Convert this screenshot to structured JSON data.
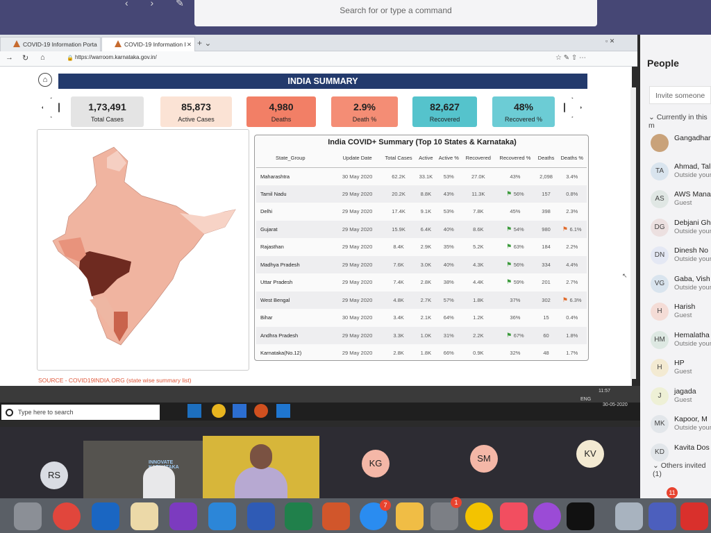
{
  "teams": {
    "search_placeholder": "Search for or type a command"
  },
  "browser": {
    "tabs": [
      {
        "label": "COVID-19 Information Porta"
      },
      {
        "label": "COVID-19 Information I"
      }
    ],
    "url": "https://warroom.karnataka.gov.in/"
  },
  "dashboard": {
    "title": "INDIA SUMMARY",
    "kpis": [
      {
        "value": "1,73,491",
        "label": "Total Cases",
        "color": "#e4e4e4"
      },
      {
        "value": "85,873",
        "label": "Active Cases",
        "color": "#fbe3d5"
      },
      {
        "value": "4,980",
        "label": "Deaths",
        "color": "#f27f66"
      },
      {
        "value": "2.9%",
        "label": "Death %",
        "color": "#f48d75"
      },
      {
        "value": "82,627",
        "label": "Recovered",
        "color": "#55c3cc"
      },
      {
        "value": "48%",
        "label": "Recovered %",
        "color": "#6cccd5"
      }
    ],
    "source": "SOURCE - COVID19INDIA.ORG (state wise summary list)",
    "table_title": "India COVID+ Summary (Top 10 States & Karnataka)",
    "columns": [
      "State_Group",
      "Update Date",
      "Total Cases",
      "Active",
      "Active %",
      "Recovered",
      "Recovered %",
      "Deaths",
      "Deaths %"
    ],
    "rows": [
      [
        "Maharashtra",
        "30 May 2020",
        "62.2K",
        "33.1K",
        "53%",
        "27.0K",
        "43%",
        "2,098",
        "3.4%",
        "",
        ""
      ],
      [
        "Tamil Nadu",
        "29 May 2020",
        "20.2K",
        "8.8K",
        "43%",
        "11.3K",
        "56%",
        "157",
        "0.8%",
        "g",
        ""
      ],
      [
        "Delhi",
        "29 May 2020",
        "17.4K",
        "9.1K",
        "53%",
        "7.8K",
        "45%",
        "398",
        "2.3%",
        "",
        ""
      ],
      [
        "Gujarat",
        "29 May 2020",
        "15.9K",
        "6.4K",
        "40%",
        "8.6K",
        "54%",
        "980",
        "6.1%",
        "g",
        "r"
      ],
      [
        "Rajasthan",
        "29 May 2020",
        "8.4K",
        "2.9K",
        "35%",
        "5.2K",
        "63%",
        "184",
        "2.2%",
        "g",
        ""
      ],
      [
        "Madhya Pradesh",
        "29 May 2020",
        "7.6K",
        "3.0K",
        "40%",
        "4.3K",
        "56%",
        "334",
        "4.4%",
        "g",
        ""
      ],
      [
        "Uttar Pradesh",
        "29 May 2020",
        "7.4K",
        "2.8K",
        "38%",
        "4.4K",
        "59%",
        "201",
        "2.7%",
        "g",
        ""
      ],
      [
        "West Bengal",
        "29 May 2020",
        "4.8K",
        "2.7K",
        "57%",
        "1.8K",
        "37%",
        "302",
        "6.3%",
        "",
        "r"
      ],
      [
        "Bihar",
        "30 May 2020",
        "3.4K",
        "2.1K",
        "64%",
        "1.2K",
        "36%",
        "15",
        "0.4%",
        "",
        ""
      ],
      [
        "Andhra Pradesh",
        "29 May 2020",
        "3.3K",
        "1.0K",
        "31%",
        "2.2K",
        "67%",
        "60",
        "1.8%",
        "g",
        ""
      ],
      [
        "Karnataka(No.12)",
        "29 May 2020",
        "2.8K",
        "1.8K",
        "66%",
        "0.9K",
        "32%",
        "48",
        "1.7%",
        "",
        ""
      ]
    ]
  },
  "windows": {
    "search": "Type here to search",
    "time": "11:57",
    "date": "30-05-2020",
    "lang": "ENG"
  },
  "people": {
    "title": "People",
    "invite": "Invite someone",
    "current": "Currently in this m",
    "list": [
      {
        "initials": "",
        "name": "Gangadhar",
        "status": "",
        "color": "#c9a27a"
      },
      {
        "initials": "TA",
        "name": "Ahmad, Tal",
        "status": "Outside your",
        "color": "#d9e4ee"
      },
      {
        "initials": "AS",
        "name": "AWS Mana",
        "status": "Guest",
        "color": "#e0e7e4"
      },
      {
        "initials": "DG",
        "name": "Debjani Gh",
        "status": "Outside your",
        "color": "#ece0e0"
      },
      {
        "initials": "DN",
        "name": "Dinesh No",
        "status": "Outside your",
        "color": "#e4e8f4"
      },
      {
        "initials": "VG",
        "name": "Gaba, Vish",
        "status": "Outside your",
        "color": "#d9e4ee"
      },
      {
        "initials": "H",
        "name": "Harish",
        "status": "Guest",
        "color": "#f4dcd6"
      },
      {
        "initials": "HM",
        "name": "Hemalatha",
        "status": "Outside your",
        "color": "#dde8e2"
      },
      {
        "initials": "H",
        "name": "HP",
        "status": "Guest",
        "color": "#f3ead2"
      },
      {
        "initials": "J",
        "name": "jagada",
        "status": "Guest",
        "color": "#eef0d6"
      },
      {
        "initials": "MK",
        "name": "Kapoor, M",
        "status": "Outside your",
        "color": "#e2e6ea"
      },
      {
        "initials": "KD",
        "name": "Kavita Dos",
        "status": "",
        "color": "#e2e6ea"
      }
    ],
    "others": "Others invited (1)"
  },
  "video": {
    "tiles": [
      "RS",
      "KG",
      "SM",
      "KV"
    ],
    "banner": "INNOVATE KARNATAKA"
  },
  "dock_badges": {
    "appstore": "7",
    "settings": "1",
    "teams": "11"
  }
}
